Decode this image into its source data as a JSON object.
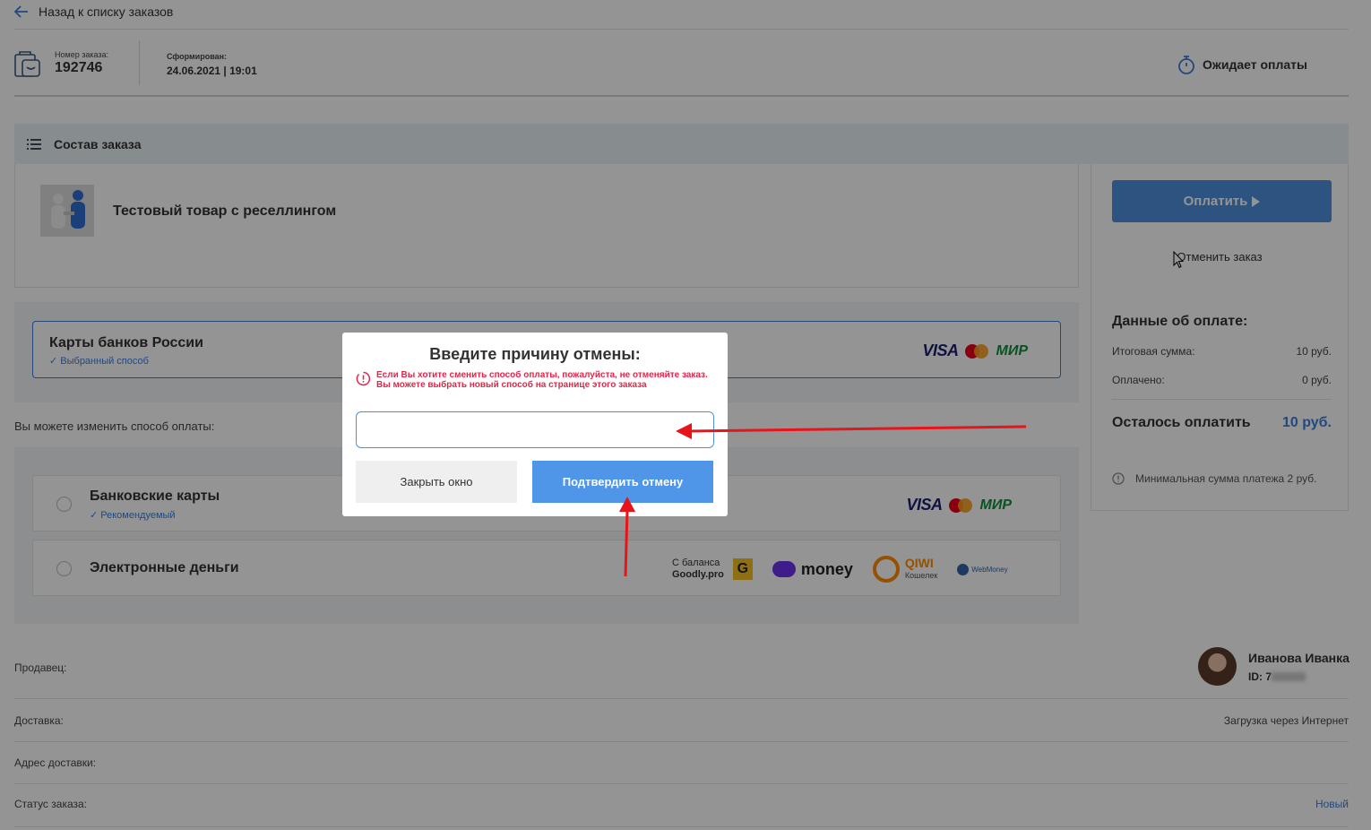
{
  "nav": {
    "back_label": "Назад к списку заказов"
  },
  "order": {
    "number_label": "Номер заказа:",
    "number": "192746",
    "created_label": "Сформирован:",
    "created": "24.06.2021 | 19:01",
    "status": "Ожидает оплаты"
  },
  "composition": {
    "title": "Состав заказа",
    "product_name": "Тестовый товар с реселлингом"
  },
  "side": {
    "pay_button": "Оплатить",
    "cancel_link": "Отменить заказ",
    "payment_title": "Данные об оплате:",
    "total_label": "Итоговая сумма:",
    "total_value": "10 руб.",
    "paid_label": "Оплачено:",
    "paid_value": "0 руб.",
    "left_label": "Осталось оплатить",
    "left_value": "10 руб.",
    "min_note": "Минимальная сумма платежа 2 руб."
  },
  "payment": {
    "selected_title": "Карты банков России",
    "selected_sub": "✓ Выбранный способ",
    "change_label": "Вы можете изменить способ оплаты:",
    "methods": [
      {
        "title": "Банковские карты",
        "sub": "✓ Рекомендуемый"
      },
      {
        "title": "Электронные деньги"
      }
    ],
    "logos": {
      "visa": "VISA",
      "mir": "МИР",
      "goodly_line1": "С баланса",
      "goodly_line2": "Goodly.pro",
      "goodly_badge": "G",
      "yoomoney": "money",
      "qiwi": "QIWI",
      "qiwi_sub": "Кошелек",
      "webmoney": "WebMoney"
    }
  },
  "info": {
    "seller_label": "Продавец:",
    "seller_name": "Иванова Иванка",
    "seller_id": "ID: 7",
    "delivery_label": "Доставка:",
    "delivery_value": "Загрузка через Интернет",
    "address_label": "Адрес доставки:",
    "status_label": "Статус заказа:",
    "status_value": "Новый"
  },
  "modal": {
    "title": "Введите причину отмены:",
    "warning": "Если Вы хотите сменить способ оплаты, пожалуйста, не отменяйте заказ. Вы можете выбрать новый способ на странице этого заказа",
    "input_value": "",
    "close_button": "Закрыть окно",
    "confirm_button": "Подтвердить отмену"
  },
  "colors": {
    "accent": "#4f8fde",
    "link": "#3b7dd8",
    "warning": "#e1264a",
    "annotation_arrow": "#e8141c"
  }
}
